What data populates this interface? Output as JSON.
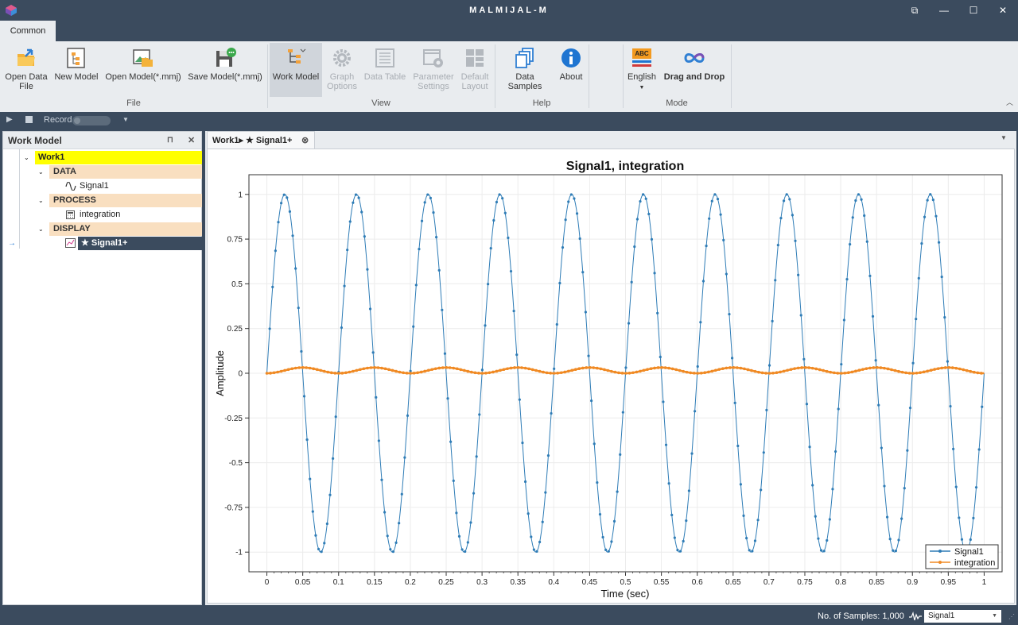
{
  "app": {
    "title": "MALMIJAL-M"
  },
  "window_controls": {
    "restore_glyph": "⧉",
    "minimize_glyph": "—",
    "maximize_glyph": "☐",
    "close_glyph": "✕"
  },
  "ribbon": {
    "tab": "Common",
    "groups": {
      "file": "File",
      "view": "View",
      "help": "Help",
      "mode": "Mode"
    },
    "buttons": {
      "open_data_file_1": "Open Data",
      "open_data_file_2": "File",
      "new_model": "New Model",
      "open_model": "Open Model(*.mmj)",
      "save_model": "Save Model(*.mmj)",
      "work_model": "Work Model",
      "graph_options_1": "Graph",
      "graph_options_2": "Options",
      "data_table": "Data Table",
      "parameter_settings_1": "Parameter",
      "parameter_settings_2": "Settings",
      "default_layout_1": "Default",
      "default_layout_2": "Layout",
      "data_samples": "Data Samples",
      "about": "About",
      "english": "English",
      "drag_and_drop": "Drag and Drop",
      "abc_badge": "ABC"
    }
  },
  "record_bar": {
    "record_label": "Record"
  },
  "work_model_panel": {
    "title": "Work Model",
    "pin_glyph": "⊓",
    "close_glyph": "✕",
    "tree": {
      "root": "Work1",
      "data": "DATA",
      "signal1": "Signal1",
      "process": "PROCESS",
      "integration": "integration",
      "display": "DISPLAY",
      "display_item": "★ Signal1+"
    }
  },
  "document": {
    "tab_label": "Work1▸ ★ Signal1+",
    "tab_close_glyph": "⊗"
  },
  "chart_data": {
    "type": "line",
    "title": "Signal1, integration",
    "xlabel": "Time (sec)",
    "ylabel": "Amplitude",
    "xlim": [
      -0.025,
      1.025
    ],
    "ylim": [
      -1.11,
      1.11
    ],
    "x_ticks": [
      "0",
      "0.05",
      "0.1",
      "0.15",
      "0.2",
      "0.25",
      "0.3",
      "0.35",
      "0.4",
      "0.45",
      "0.5",
      "0.55",
      "0.6",
      "0.65",
      "0.7",
      "0.75",
      "0.8",
      "0.85",
      "0.9",
      "0.95",
      "1"
    ],
    "y_ticks": [
      "1",
      "0.75",
      "0.5",
      "0.25",
      "0",
      "-0.25",
      "-0.5",
      "-0.75",
      "-1"
    ],
    "legend_position": "bottom-right",
    "grid": true,
    "series": [
      {
        "name": "Signal1",
        "color": "#2e7cb6",
        "marker": "dot",
        "formula": "sin(2π·10·t)",
        "samples": 1000,
        "t_start": 0,
        "t_end": 1
      },
      {
        "name": "integration",
        "color": "#f08a24",
        "marker": "dot",
        "formula": "(1−cos(2π·10·t))/(2π·10)",
        "samples": 1000,
        "t_start": 0,
        "t_end": 1,
        "peak": 0.0318
      }
    ]
  },
  "status": {
    "samples_text": "No. of Samples: 1,000",
    "signal_selector_value": "Signal1"
  },
  "colors": {
    "chrome": "#3b4b5e",
    "ribbon_bg": "#e9ecef",
    "tree_root_highlight": "#ffff00",
    "tree_group_bg": "#f9dfc0",
    "tree_selected_bg": "#3b4b5e"
  }
}
